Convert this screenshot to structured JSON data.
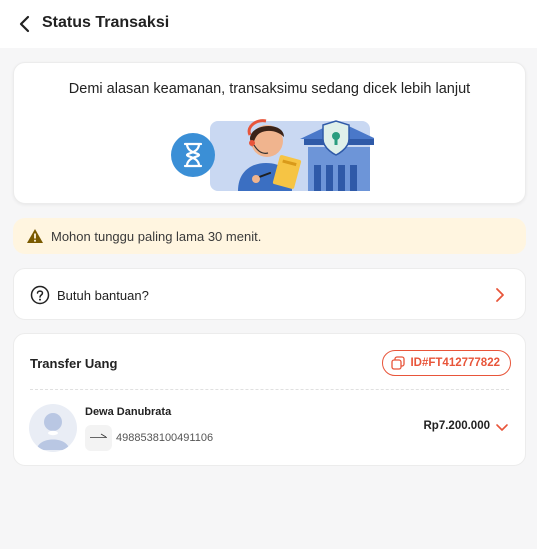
{
  "header": {
    "title": "Status Transaksi"
  },
  "status": {
    "message": "Demi alasan keamanan, transaksimu sedang dicek lebih lanjut"
  },
  "warning": {
    "text": "Mohon tunggu paling lama 30 menit."
  },
  "help": {
    "label": "Butuh bantuan?"
  },
  "transaction": {
    "title": "Transfer Uang",
    "id": "ID#FT412777822",
    "recipient_name": "Dewa Danubrata",
    "account_number": "4988538100491106",
    "amount": "Rp7.200.000"
  },
  "colors": {
    "accent": "#e8553a",
    "warning_bg": "#fff5e0",
    "illus_blue": "#4a78c9",
    "illus_light": "#c9d8f2",
    "hourglass": "#3b8fd6"
  },
  "icons": [
    "back-arrow-icon",
    "hourglass-icon",
    "warning-triangle-icon",
    "question-circle-icon",
    "chevron-right-icon",
    "copy-icon",
    "chevron-down-icon"
  ]
}
